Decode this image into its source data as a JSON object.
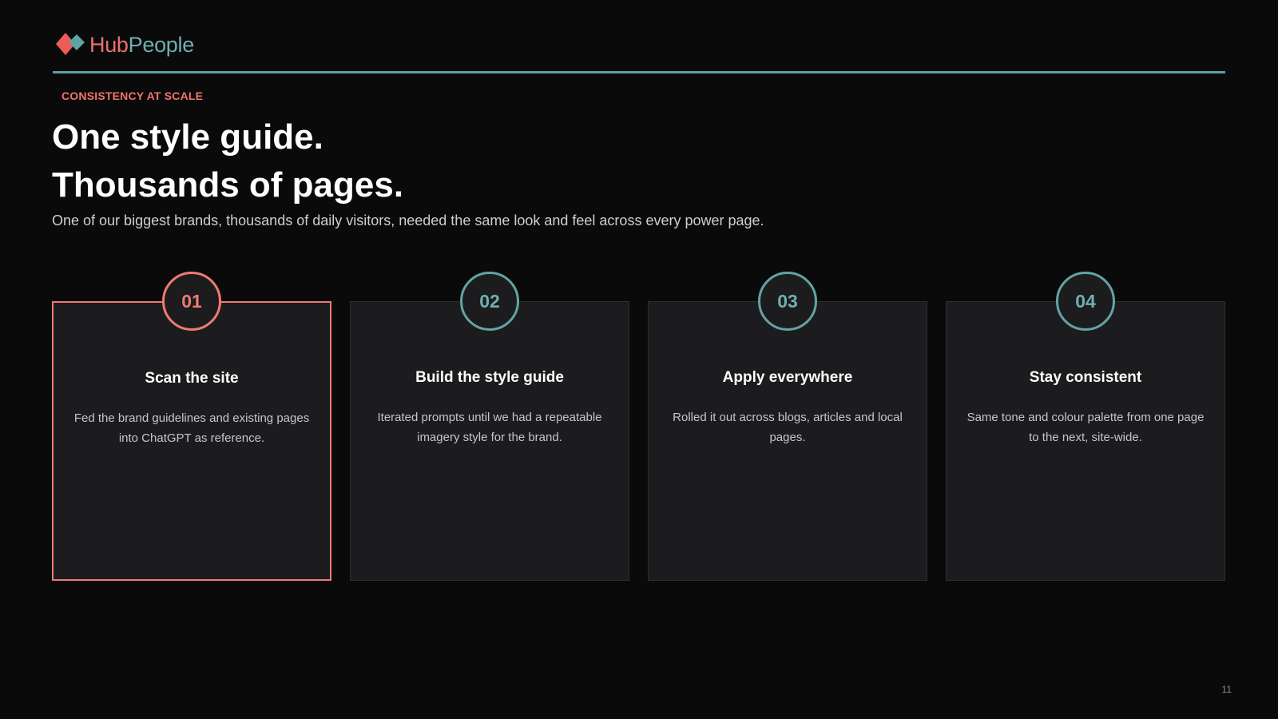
{
  "brand": {
    "name_part1": "Hub",
    "name_part2": "People",
    "accent_coral": "#ef7b72",
    "accent_teal": "#64a3a4"
  },
  "header": {
    "eyebrow": "CONSISTENCY AT SCALE",
    "title_line1": "One style guide.",
    "title_line2": "Thousands of pages.",
    "subtitle": "One of our biggest brands, thousands of daily visitors, needed the same look and feel across every power page."
  },
  "steps": [
    {
      "number": "01",
      "title": "Scan the site",
      "description": "Fed the brand guidelines and existing pages into ChatGPT as reference.",
      "highlighted": true
    },
    {
      "number": "02",
      "title": "Build the style guide",
      "description": "Iterated prompts until we had a repeatable imagery style for the brand.",
      "highlighted": false
    },
    {
      "number": "03",
      "title": "Apply everywhere",
      "description": "Rolled it out across blogs, articles and local pages.",
      "highlighted": false
    },
    {
      "number": "04",
      "title": "Stay consistent",
      "description": "Same tone and colour palette from one page to the next, site-wide.",
      "highlighted": false
    }
  ],
  "footer": {
    "page_number": "11"
  }
}
